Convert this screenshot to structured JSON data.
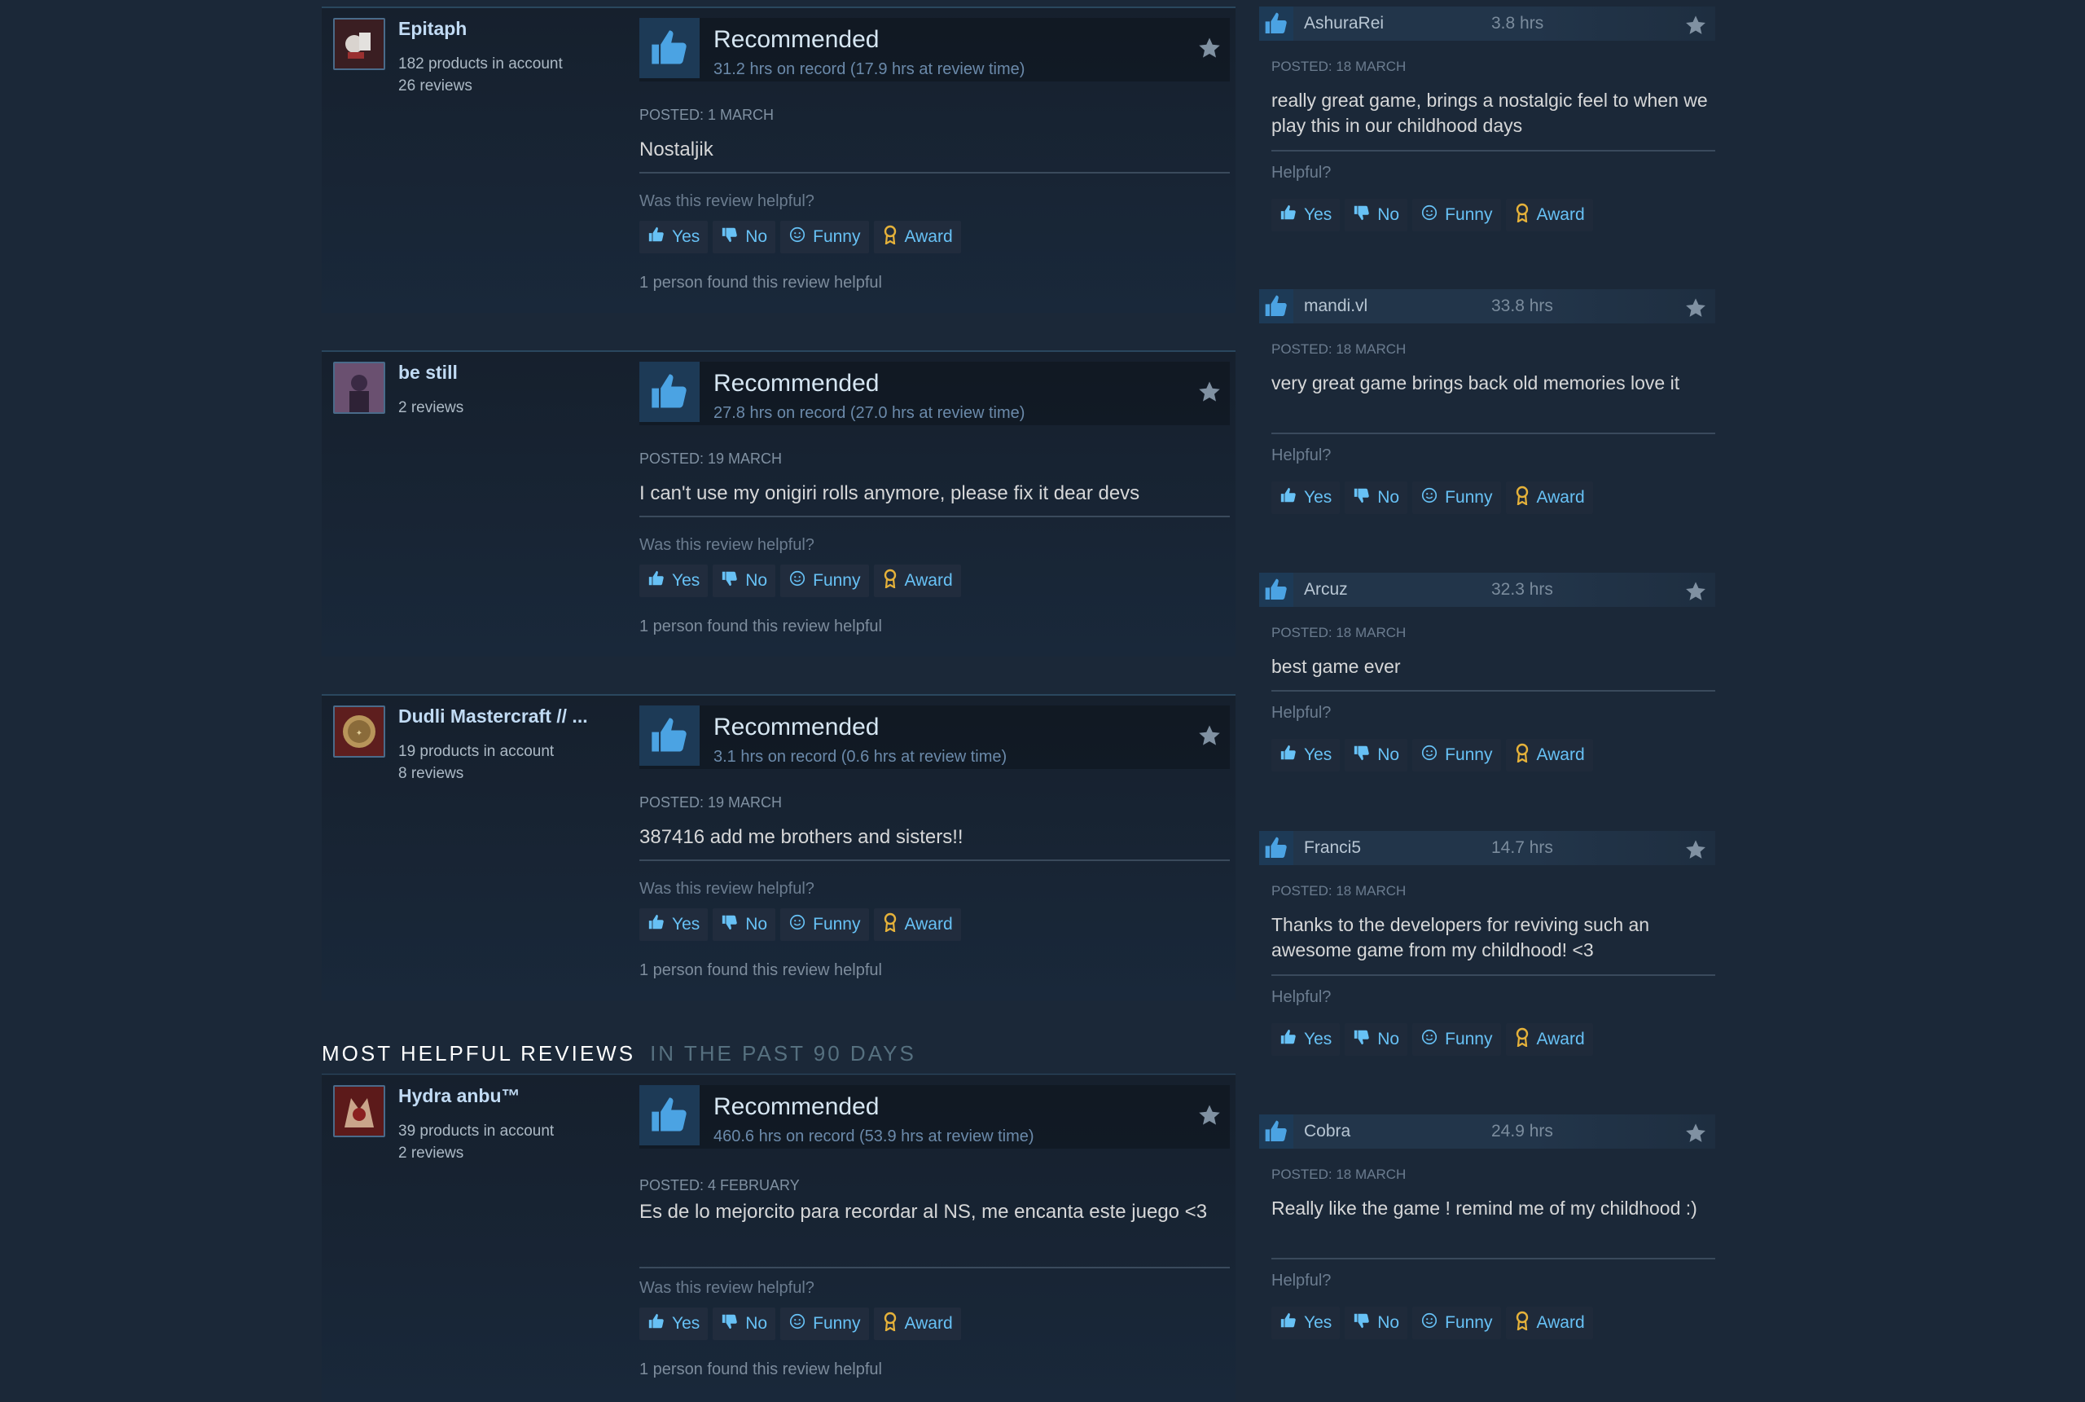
{
  "labels": {
    "recommended": "Recommended",
    "posted_prefix": "POSTED: ",
    "helpful_question": "Was this review helpful?",
    "helpful_short": "Helpful?",
    "yes": "Yes",
    "no": "No",
    "funny": "Funny",
    "award": "Award"
  },
  "section": {
    "title": "MOST HELPFUL REVIEWS",
    "subtitle": "IN THE PAST 90 DAYS"
  },
  "reviews": [
    {
      "author": "Epitaph",
      "meta1": "182 products in account",
      "meta2": "26 reviews",
      "hours": "31.2 hrs on record (17.9 hrs at review time)",
      "posted": "POSTED: 1 MARCH",
      "text": "Nostaljik",
      "helpful_count": "1 person found this review helpful",
      "avatar_color": "#5a2a2a"
    },
    {
      "author": "be still",
      "meta1": "2 reviews",
      "meta2": "",
      "hours": "27.8 hrs on record (27.0 hrs at review time)",
      "posted": "POSTED: 19 MARCH",
      "text": "I can't use my onigiri rolls anymore, please fix it dear devs",
      "helpful_count": "1 person found this review helpful",
      "avatar_color": "#6b4a6e"
    },
    {
      "author": "Dudli Mastercraft // ...",
      "meta1": "19 products in account",
      "meta2": "8 reviews",
      "hours": "3.1 hrs on record (0.6 hrs at review time)",
      "posted": "POSTED: 19 MARCH",
      "text": "387416 add me brothers and sisters!!",
      "helpful_count": "1 person found this review helpful",
      "avatar_color": "#7a2b2b"
    },
    {
      "author": "Hydra anbu™",
      "meta1": "39 products in account",
      "meta2": "2 reviews",
      "hours": "460.6 hrs on record (53.9 hrs at review time)",
      "posted": "POSTED: 4 FEBRUARY",
      "text": "Es de lo mejorcito para recordar al NS, me encanta este juego <3",
      "helpful_count": "1 person found this review helpful",
      "avatar_color": "#8a2a2a"
    }
  ],
  "recent": [
    {
      "author": "AshuraRei",
      "hours": "3.8 hrs",
      "posted": "POSTED: 18 MARCH",
      "text": "really great game, brings a nostalgic feel to when we play this in our childhood days"
    },
    {
      "author": "mandi.vl",
      "hours": "33.8 hrs",
      "posted": "POSTED: 18 MARCH",
      "text": "very great game brings back old memories love it"
    },
    {
      "author": "Arcuz",
      "hours": "32.3 hrs",
      "posted": "POSTED: 18 MARCH",
      "text": "best game ever"
    },
    {
      "author": "Franci5",
      "hours": "14.7 hrs",
      "posted": "POSTED: 18 MARCH",
      "text": "Thanks to the developers for reviving such an awesome game from my childhood! <3"
    },
    {
      "author": "Cobra",
      "hours": "24.9 hrs",
      "posted": "POSTED: 18 MARCH",
      "text": "Really like the game ! remind me of my childhood :)"
    }
  ],
  "colors": {
    "background": "#1b2838",
    "link": "#67c1f5",
    "award": "#e6b23a",
    "thumb": "#4ba3e3"
  }
}
